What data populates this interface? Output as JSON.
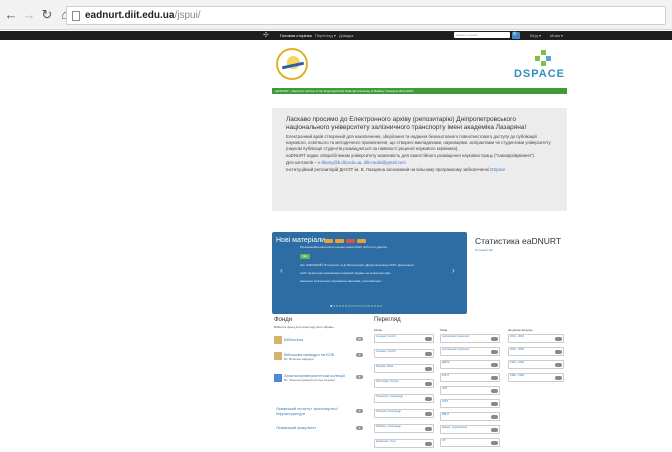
{
  "browser": {
    "back_icon": "arrow-left-icon",
    "forward_icon": "arrow-right-icon",
    "reload_icon": "reload-icon",
    "home_icon": "home-icon",
    "url_host": "eadnurt.diit.edu.ua",
    "url_path": "/jspui/"
  },
  "topnav": {
    "home": "Головна сторінка",
    "browse": "Перегляд ▾",
    "help": "Довідка",
    "search_placeholder": "Шукати в архіві",
    "search_btn": "🔍",
    "login": "Вхід ▾",
    "lang": "Мова ▾"
  },
  "header": {
    "dspace": "DSPACE",
    "tagline": "eaDNURT - electronic archive of the Dnipropetrovsk National University of Railway Transport 2014-2016"
  },
  "welcome": {
    "title": "Ласкаво просимо до Електронного архіву (репозитарію) Дніпропетровського національного університету залізничного транспорту імені академіка Лазаряна!",
    "p1": "Електронний архів створений для накопичення, зберігання та надання безкоштовного повнотекстового доступу до публікацій наукового, освітнього та методичного призначення, що створені викладачами, науковцями, аспірантами чи студентами університету (наукові публікації студентів розміщуються за наявності рецензії наукового керівника).",
    "p2": "eaDNURT надає співробітникам університету можливість для самостійного розміщення наукових праць (\"самоархівування\").",
    "contacts_label": "Для контактів –",
    "contacts": "e-library@b.diit.edu.ua, dilt.media@gmail.com",
    "p4": "Інституційний репозитарій ДНУЗТ ім. В. Лазаряна заснований на вільному програмному забезпеченні",
    "p4_link": "DSpace"
  },
  "slider": {
    "title": "Нові матеріали",
    "line1": "Організаційно-методичні основи самостійної роботи студентів...",
    "line2": "Шп. ЗАБІЛАКИЙ, В.Соколов та Д. Виноградов, Дніпропетровськ 2015. Дисертація...",
    "line3": "робіт практичних визначення наукових видань на основі методів...",
    "line4": "вивчення залізничних перевезень вантажів у контейнерах...",
    "btn": "Ще",
    "prev": "‹",
    "next": "›",
    "dots": "●○○○○○○○○○○○○○○○○○"
  },
  "stats": {
    "title": "Статистика eaDNURT",
    "link": "Останній звіт"
  },
  "communities": {
    "title": "Фонди",
    "subtitle": "Виберіть фонд для перегляду його зібрань.",
    "items": [
      {
        "name": "Бібліотека",
        "count": "20",
        "sub": ""
      },
      {
        "name": "Військова кафедра на БПБ",
        "count": "4",
        "sub": "Вс. Власник кафедри"
      },
      {
        "name": "Загальноуніверситетські колекції",
        "count": "8",
        "sub": "Вс. Загальноуніверситетські колекції"
      },
      {
        "name": "Львівський інститут транспортної інфраструктури",
        "count": "4",
        "sub": ""
      },
      {
        "name": "Львівський факультет",
        "count": "2",
        "sub": ""
      }
    ]
  },
  "browse": {
    "title": "Перегляд",
    "authors_head": "Автор",
    "subjects_head": "Тема",
    "dates_head": "За датою випуску",
    "authors": [
      "Ільченко, Сергій",
      "Ільченко, Сергій",
      "Боровко, Вовк",
      "Лихтянова, Тетяна",
      "Пшеничко, Олександр",
      "Пеляхов, Олександр",
      "Рибалко, Олександр",
      "Кравченко, Олег"
    ],
    "subjects": [
      "залізничний транспорт",
      "залізничний транспорт",
      "ДЕРЖ",
      "ЕХНТ",
      "НТБ",
      "КАТЗ",
      "ВВНТ",
      "міжнар. перевезення",
      "ЗП"
    ],
    "dates": [
      "2010 - 2019",
      "2000 - 2009",
      "1990 - 1999",
      "1980 - 1989"
    ]
  }
}
